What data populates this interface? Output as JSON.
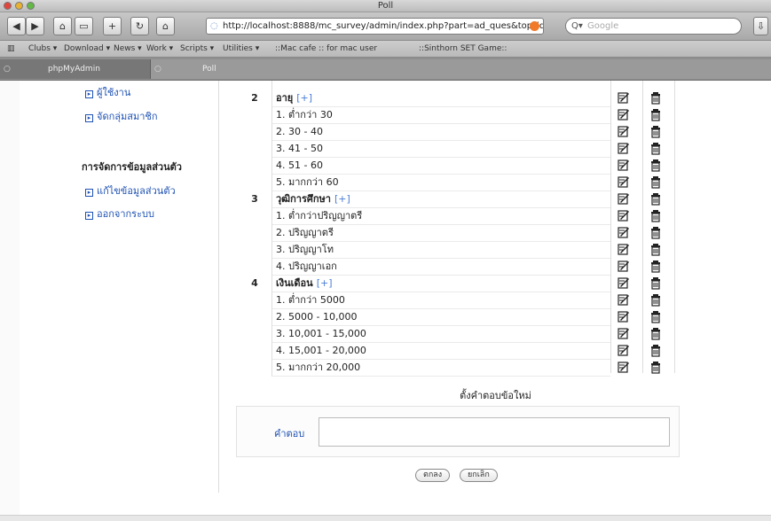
{
  "window": {
    "title": "Poll"
  },
  "toolbar": {
    "url": "http://localhost:8888/mc_survey/admin/index.php?part=ad_ques&top_id=",
    "search_placeholder": "Google"
  },
  "bookmarks": [
    "Clubs ▾",
    "Download ▾",
    "News ▾",
    "Work ▾",
    "Scripts ▾",
    "Utilities ▾",
    "::Mac cafe :: for mac user",
    "::Sinthorn SET Game::"
  ],
  "tabs": [
    {
      "label": "phpMyAdmin"
    },
    {
      "label": "Poll"
    }
  ],
  "sidebar": {
    "items_top": [
      {
        "label": "ผู้ใช้งาน"
      },
      {
        "label": "จัดกลุ่มสมาชิก"
      }
    ],
    "section_title": "การจัดการข้อมูลส่วนตัว",
    "items_bottom": [
      {
        "label": "แก้ไขข้อมูลส่วนตัว"
      },
      {
        "label": "ออกจากระบบ"
      }
    ]
  },
  "questions": [
    {
      "num": "2",
      "title": "อายุ",
      "add": "[+]",
      "answers": [
        "1. ต่ำกว่า 30",
        "2. 30 - 40",
        "3. 41 - 50",
        "4. 51 - 60",
        "5. มากกว่า 60"
      ]
    },
    {
      "num": "3",
      "title": "วุฒิการศึกษา",
      "add": "[+]",
      "answers": [
        "1. ต่ำกว่าปริญญาตรี",
        "2. ปริญญาตรี",
        "3. ปริญญาโท",
        "4. ปริญญาเอก"
      ]
    },
    {
      "num": "4",
      "title": "เงินเดือน",
      "add": "[+]",
      "answers": [
        "1. ต่ำกว่า 5000",
        "2. 5000 - 10,000",
        "3. 10,001 - 15,000",
        "4. 15,001 - 20,000",
        "5. มากกว่า 20,000"
      ]
    }
  ],
  "new_answer": {
    "title": "ตั้งคำตอบข้อใหม่",
    "label": "คำตอบ",
    "value": ""
  },
  "buttons": {
    "submit": "ตกลง",
    "cancel": "ยกเลิก"
  },
  "colors": {
    "link": "#1f52b3",
    "add": "#4a7dd6"
  }
}
